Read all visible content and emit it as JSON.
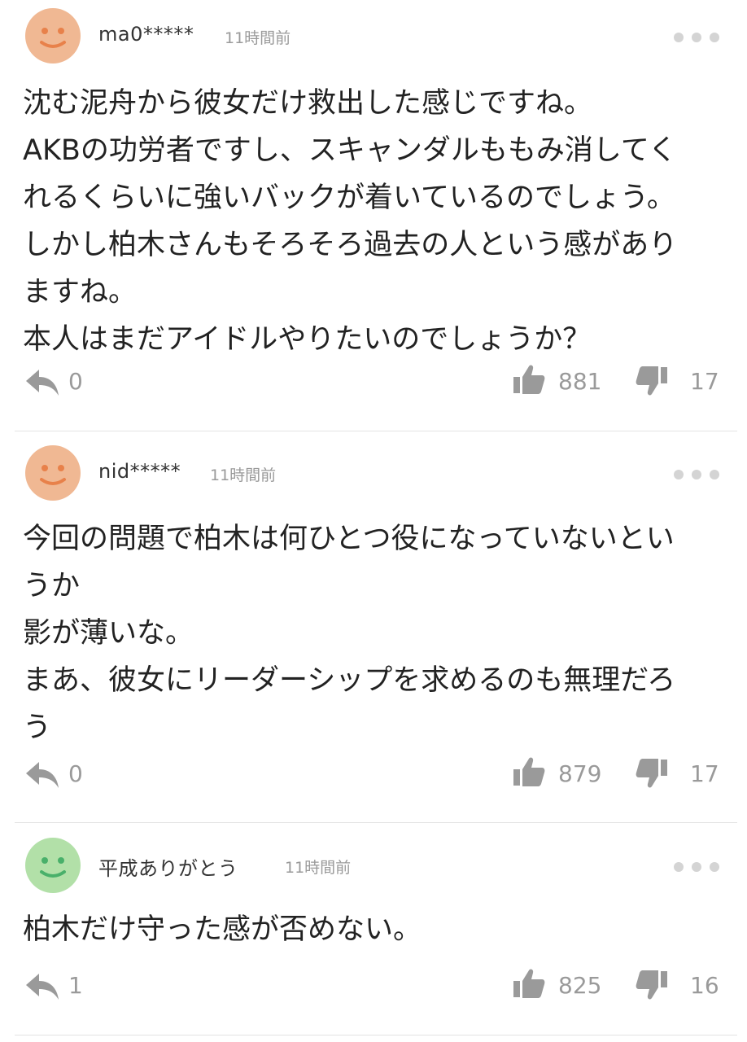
{
  "comments": [
    {
      "username": "ma0*****",
      "time": "11時間前",
      "avatar_color": "#f0b893",
      "avatar_face_color": "#e8814a",
      "lines": [
        "沈む泥舟から彼女だけ救出した感じですね。",
        "AKBの功労者ですし、スキャンダルももみ消してく",
        "れるくらいに強いバックが着いているのでしょう。",
        "しかし柏木さんもそろそろ過去の人という感があり",
        "ますね。",
        "本人はまだアイドルやりたいのでしょうか？"
      ],
      "reply_count": "0",
      "like_count": "881",
      "dislike_count": "17"
    },
    {
      "username": "nid*****",
      "time": "11時間前",
      "avatar_color": "#f0b893",
      "avatar_face_color": "#e8814a",
      "lines": [
        "今回の問題で柏木は何ひとつ役になっていないとい",
        "うか",
        "影が薄いな。",
        "まあ、彼女にリーダーシップを求めるのも無理だろ",
        "う"
      ],
      "reply_count": "0",
      "like_count": "879",
      "dislike_count": "17"
    },
    {
      "username": "平成ありがとう",
      "time": "11時間前",
      "avatar_color": "#b2e0a8",
      "avatar_face_color": "#49b06a",
      "lines": [
        "柏木だけ守った感が否めない。"
      ],
      "reply_count": "1",
      "like_count": "825",
      "dislike_count": "16"
    }
  ],
  "icons": {
    "reply": "reply-icon",
    "like": "thumbs-up-icon",
    "dislike": "thumbs-down-icon",
    "more": "more-options-icon",
    "icon_color": "#9a9a9a"
  }
}
